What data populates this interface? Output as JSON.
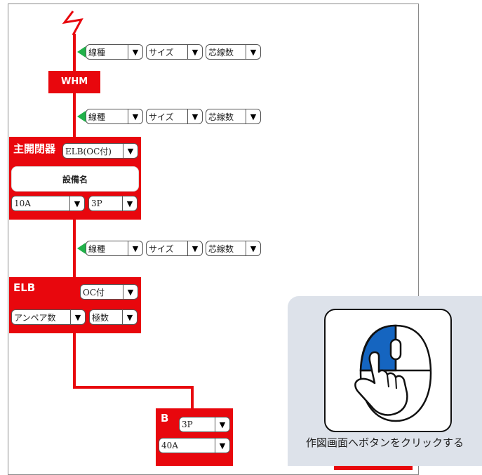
{
  "wire_rows": [
    {
      "line_type": "線種",
      "size": "サイズ",
      "cores": "芯線数"
    },
    {
      "line_type": "線種",
      "size": "サイズ",
      "cores": "芯線数"
    },
    {
      "line_type": "線種",
      "size": "サイズ",
      "cores": "芯線数"
    }
  ],
  "whm": {
    "label": "WHM"
  },
  "main_breaker": {
    "title": "主開閉器",
    "type_value": "ELB(OC付)",
    "equipment_name": "設備名",
    "current_value": "10A",
    "poles_value": "3P"
  },
  "elb": {
    "title": "ELB",
    "oc_value": "OC付",
    "ampere_value": "アンペア数",
    "poles_value": "極数"
  },
  "breaker_b": {
    "title": "B",
    "poles_value": "3P",
    "current_value": "40A"
  },
  "dropdown_arrow": "▼",
  "hint": {
    "text": "作図画面へボタンをクリックする"
  },
  "colors": {
    "wire": "#e8070d",
    "arrow": "#21b24a",
    "highlight": "#1565c0"
  },
  "icons": {
    "mouse": "mouse-left-click-icon",
    "hand": "pointing-hand-icon"
  }
}
